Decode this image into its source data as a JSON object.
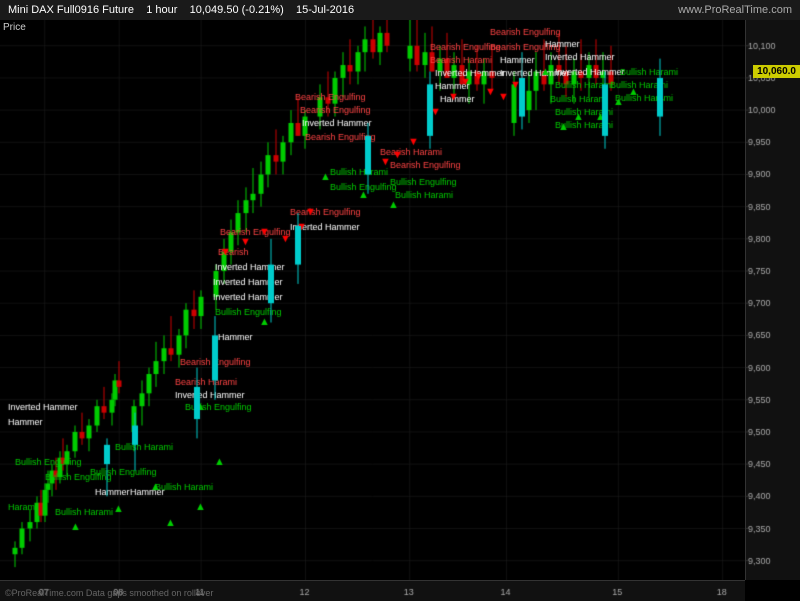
{
  "header": {
    "title": "Mini DAX Full0916 Future",
    "timeframe": "1 hour",
    "price": "10,049.50 (-0.21%)",
    "date": "15-Jul-2016",
    "website": "www.ProRealTime.com"
  },
  "chart": {
    "price_label": "Price",
    "current_price": "10,060.0",
    "footer": "©ProRealTime.com Data gaps smoothed on rollover",
    "y_axis_labels": [
      "10,100",
      "10,050",
      "10,000",
      "9,950",
      "9,900",
      "9,850",
      "9,800",
      "9,750",
      "9,700",
      "9,650",
      "9,600",
      "9,550",
      "9,500",
      "9,450",
      "9,400",
      "9,350",
      "9,300"
    ],
    "x_axis_labels": [
      "07",
      "08",
      "11",
      "12",
      "13",
      "14",
      "15",
      "18"
    ]
  },
  "patterns": {
    "bearish": "Bearish Engulfing",
    "bullish_engulfing": "Bullish Engulfing",
    "hammer": "Hammer",
    "inverted_hammer": "Inverted Hammer",
    "bullish_harami": "Bullish Harami",
    "bearish_harami": "Bearish Harami"
  }
}
